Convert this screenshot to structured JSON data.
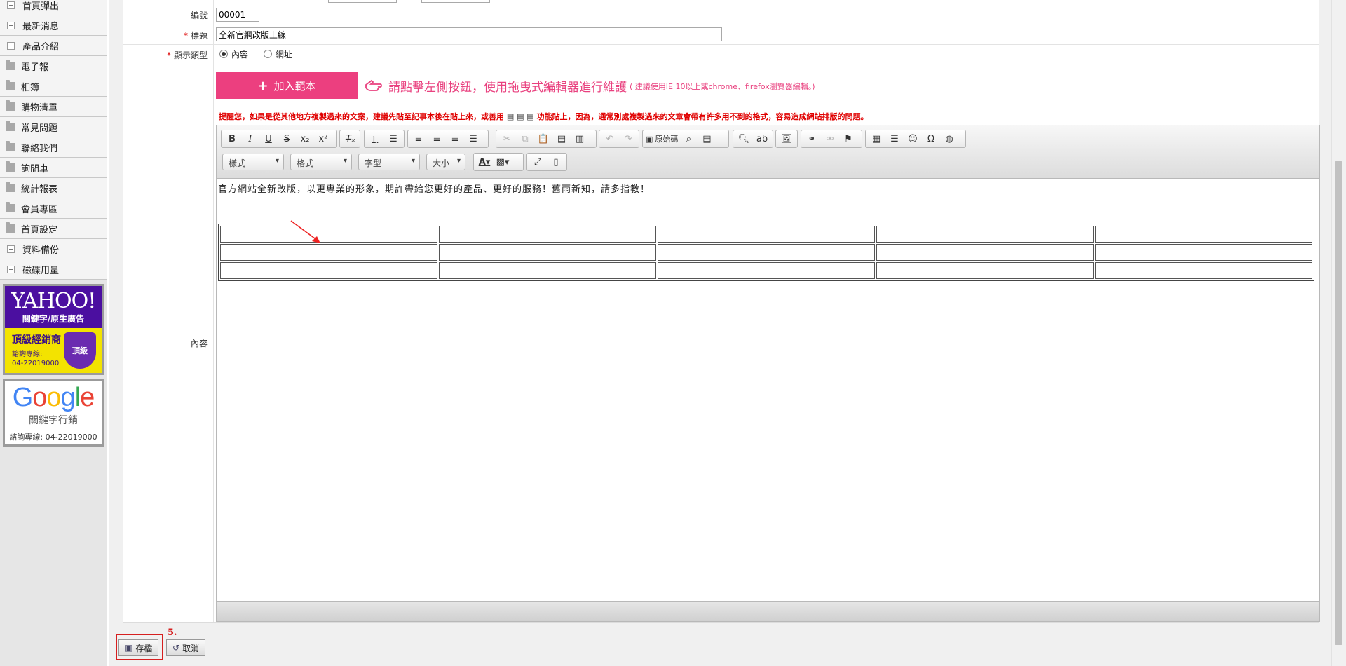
{
  "sidebar": {
    "items": [
      {
        "label": "首頁彈出",
        "icon": "box"
      },
      {
        "label": "最新消息",
        "icon": "box"
      },
      {
        "label": "產品介紹",
        "icon": "box"
      },
      {
        "label": "電子報",
        "icon": "folder"
      },
      {
        "label": "相簿",
        "icon": "folder"
      },
      {
        "label": "購物清單",
        "icon": "folder"
      },
      {
        "label": "常見問題",
        "icon": "folder"
      },
      {
        "label": "聯絡我們",
        "icon": "folder"
      },
      {
        "label": "詢問車",
        "icon": "folder"
      },
      {
        "label": "統計報表",
        "icon": "folder"
      },
      {
        "label": "會員專區",
        "icon": "folder"
      },
      {
        "label": "首頁設定",
        "icon": "folder"
      },
      {
        "label": "資料備份",
        "icon": "box"
      },
      {
        "label": "磁碟用量",
        "icon": "box"
      }
    ],
    "yahoo_ad": {
      "logo": "YAHOO!",
      "subtitle": "關鍵字/原生廣告",
      "title": "頂級經銷商",
      "contact_label": "諮詢專線:",
      "phone": "04-22019000",
      "badge": "頂級"
    },
    "google_ad": {
      "subtitle": "關鍵字行銷",
      "contact": "諮詢專線: 04-22019000"
    }
  },
  "form": {
    "number_label": "編號",
    "number_value": "00001",
    "title_label": "標題",
    "title_value": "全新官網改版上線",
    "type_label": "顯示類型",
    "type_options": [
      "內容",
      "網址"
    ],
    "content_label": "內容",
    "required_mark": "*"
  },
  "template": {
    "button_label": "加入範本",
    "hint": "請點擊左側按鈕，使用拖曳式編輯器進行維護",
    "hint_small": "( 建議使用IE 10以上或chrome、firefox瀏覽器編輯。)",
    "warning_prefix": "提醒您，如果是從其他地方複製過來的文案，建議先貼至記事本後在貼上來，或善用",
    "warning_suffix": "功能貼上，因為，通常別處複製過來的文章會帶有許多用不到的格式，容易造成網站排版的問題。"
  },
  "editor": {
    "source_label": "原始碼",
    "style_combo": "樣式",
    "format_combo": "格式",
    "font_combo": "字型",
    "size_combo": "大小",
    "content_text": "官方網站全新改版，以更專業的形象，期許帶給您更好的產品、更好的服務！舊雨新知，請多指教！",
    "table_rows": 3,
    "table_cols": 5
  },
  "footer": {
    "save_label": "存檔",
    "cancel_label": "取消",
    "step": "5."
  },
  "colors": {
    "accent_pink": "#ec3f7f",
    "warning_red": "#e00000",
    "annotation_red": "#d61f1f"
  }
}
